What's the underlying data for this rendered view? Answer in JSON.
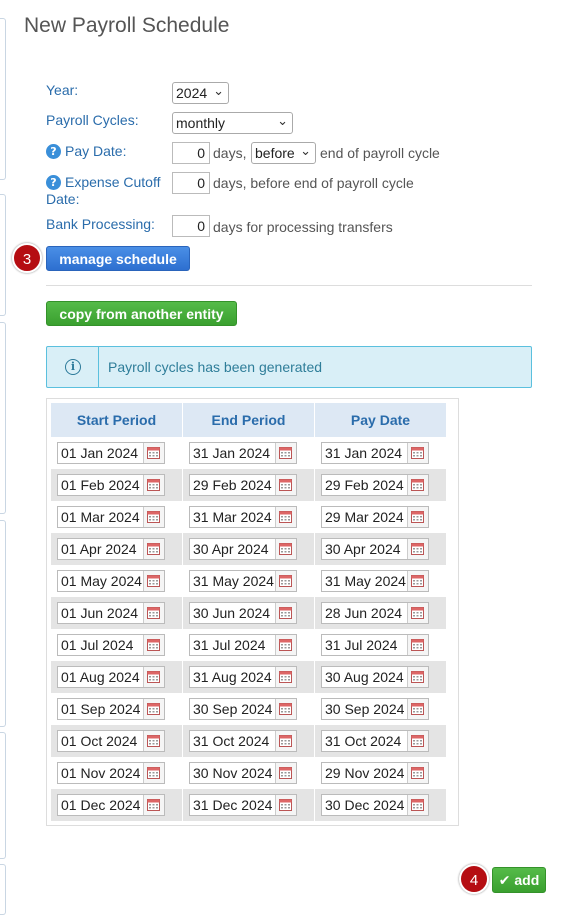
{
  "page": {
    "title": "New Payroll Schedule"
  },
  "form": {
    "year": {
      "label": "Year:",
      "value": "2024"
    },
    "payroll_cycles": {
      "label": "Payroll Cycles:",
      "value": "monthly"
    },
    "pay_date": {
      "label": "Pay Date:",
      "days": "0",
      "days_label": "days,",
      "relation": "before",
      "suffix": "end of payroll cycle"
    },
    "expense_cutoff": {
      "label": "Expense Cutoff Date:",
      "days": "0",
      "suffix": "days, before end of payroll cycle"
    },
    "bank_processing": {
      "label": "Bank Processing:",
      "days": "0",
      "suffix": "days for processing transfers"
    }
  },
  "buttons": {
    "manage_schedule": "manage schedule",
    "copy_from_entity": "copy from another entity",
    "add": "add"
  },
  "badges": {
    "manage": "3",
    "add": "4"
  },
  "alert": {
    "message": "Payroll cycles has been generated"
  },
  "table": {
    "headers": [
      "Start Period",
      "End Period",
      "Pay Date"
    ],
    "rows": [
      [
        "01 Jan 2024",
        "31 Jan 2024",
        "31 Jan 2024"
      ],
      [
        "01 Feb 2024",
        "29 Feb 2024",
        "29 Feb 2024"
      ],
      [
        "01 Mar 2024",
        "31 Mar 2024",
        "29 Mar 2024"
      ],
      [
        "01 Apr 2024",
        "30 Apr 2024",
        "30 Apr 2024"
      ],
      [
        "01 May 2024",
        "31 May 2024",
        "31 May 2024"
      ],
      [
        "01 Jun 2024",
        "30 Jun 2024",
        "28 Jun 2024"
      ],
      [
        "01 Jul 2024",
        "31 Jul 2024",
        "31 Jul 2024"
      ],
      [
        "01 Aug 2024",
        "31 Aug 2024",
        "30 Aug 2024"
      ],
      [
        "01 Sep 2024",
        "30 Sep 2024",
        "30 Sep 2024"
      ],
      [
        "01 Oct 2024",
        "31 Oct 2024",
        "31 Oct 2024"
      ],
      [
        "01 Nov 2024",
        "30 Nov 2024",
        "29 Nov 2024"
      ],
      [
        "01 Dec 2024",
        "31 Dec 2024",
        "30 Dec 2024"
      ]
    ]
  },
  "colors": {
    "link_blue": "#2a6cab",
    "primary": "#2d6fd0",
    "success": "#3aa02f",
    "badge_red": "#b50d12",
    "info_bg": "#d9eff7"
  }
}
